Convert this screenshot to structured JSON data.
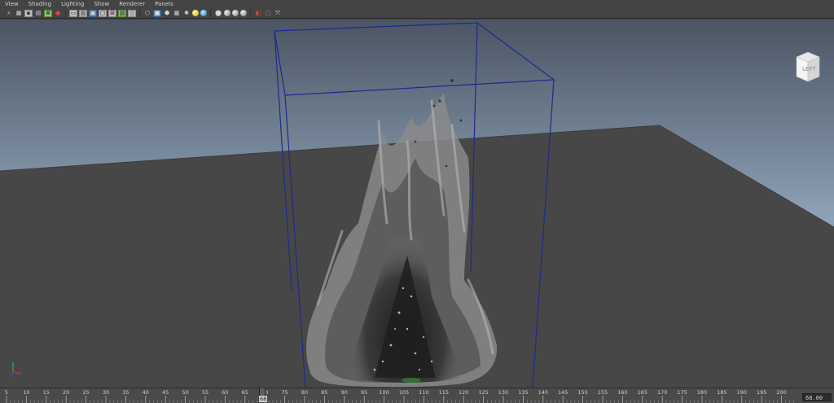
{
  "menubar": {
    "items": [
      "View",
      "Shading",
      "Lighting",
      "Show",
      "Renderer",
      "Panels"
    ]
  },
  "toolbar": {
    "icons": [
      "select-camera-icon",
      "camera-attributes-icon",
      "bookmark-icon",
      "image-plane-icon",
      "grid-icon",
      "film-gate-icon",
      "resolution-gate-icon",
      "gate-mask-icon",
      "field-chart-icon",
      "safe-action-icon",
      "wireframe-icon",
      "smooth-shade-icon",
      "wireframe-on-shaded-icon",
      "textured-icon",
      "use-lights-icon",
      "shadows-icon",
      "ambient-occlusion-icon",
      "isolate-select-icon",
      "xray-icon",
      "xray-joints-icon",
      "xray-components-icon",
      "highlight-icon",
      "camera-icon",
      "transform-icon"
    ]
  },
  "viewport": {
    "view_cube_label": "LEFT",
    "colors": {
      "sky_top": "#4b5563",
      "sky_bottom": "#8fa3b8",
      "ground": "#474747",
      "bbox": "#1f2a8c"
    }
  },
  "timeline": {
    "ticks": [
      "5",
      "10",
      "15",
      "20",
      "25",
      "30",
      "35",
      "40",
      "45",
      "50",
      "55",
      "60",
      "65",
      "70",
      "75",
      "80",
      "85",
      "90",
      "95",
      "100",
      "105",
      "110",
      "115",
      "120",
      "125",
      "130",
      "135",
      "140",
      "145",
      "150",
      "155",
      "160",
      "165",
      "170",
      "175",
      "180",
      "185",
      "190",
      "195",
      "200"
    ],
    "playhead_label": "68",
    "current_frame": "68.00"
  }
}
